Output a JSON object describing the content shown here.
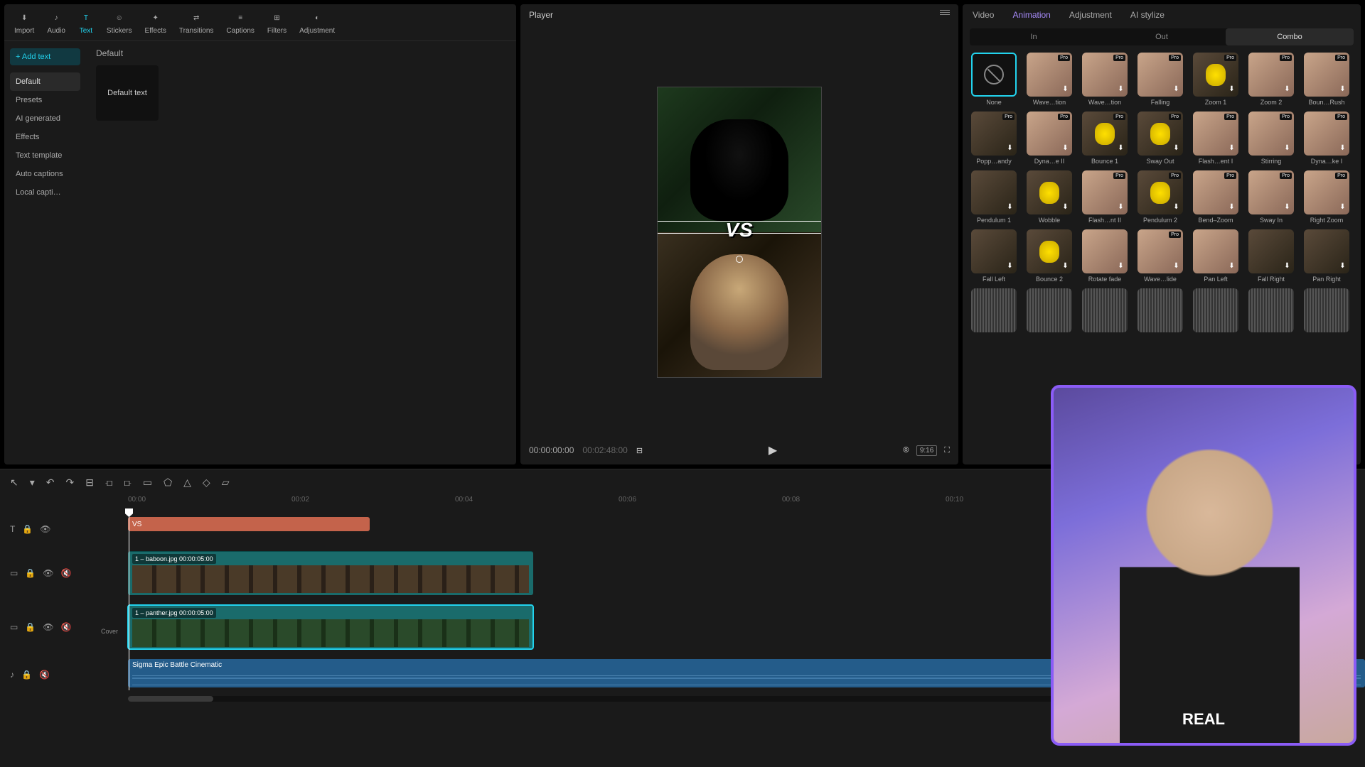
{
  "media_nav": [
    {
      "label": "Import",
      "icon": "⬇",
      "active": false
    },
    {
      "label": "Audio",
      "icon": "♪",
      "active": false
    },
    {
      "label": "Text",
      "icon": "T",
      "active": true
    },
    {
      "label": "Stickers",
      "icon": "☺",
      "active": false
    },
    {
      "label": "Effects",
      "icon": "✦",
      "active": false
    },
    {
      "label": "Transitions",
      "icon": "⇄",
      "active": false
    },
    {
      "label": "Captions",
      "icon": "≡",
      "active": false
    },
    {
      "label": "Filters",
      "icon": "⊞",
      "active": false
    },
    {
      "label": "Adjustment",
      "icon": "◐",
      "active": false
    }
  ],
  "add_text_btn": "+ Add text",
  "left_sidebar": [
    {
      "label": "Default",
      "active": true
    },
    {
      "label": "Presets",
      "active": false
    },
    {
      "label": "AI generated",
      "active": false
    },
    {
      "label": "Effects",
      "active": false
    },
    {
      "label": "Text template",
      "active": false
    },
    {
      "label": "Auto captions",
      "active": false
    },
    {
      "label": "Local capti…",
      "active": false
    }
  ],
  "left_content": {
    "heading": "Default",
    "card": "Default text"
  },
  "player": {
    "title": "Player",
    "current": "00:00:00:00",
    "duration": "00:02:48:00",
    "vs_text": "VS",
    "ratio": "9:16"
  },
  "prop_tabs": [
    {
      "label": "Video",
      "active": false
    },
    {
      "label": "Animation",
      "active": true
    },
    {
      "label": "Adjustment",
      "active": false
    },
    {
      "label": "AI stylize",
      "active": false
    }
  ],
  "anim_subtabs": [
    {
      "label": "In",
      "active": false
    },
    {
      "label": "Out",
      "active": false
    },
    {
      "label": "Combo",
      "active": true
    }
  ],
  "anim_items": [
    {
      "label": "None",
      "variant": "none",
      "pro": false,
      "dl": false
    },
    {
      "label": "Wave…tion",
      "variant": "skin",
      "pro": true,
      "dl": true
    },
    {
      "label": "Wave…tion",
      "variant": "skin",
      "pro": true,
      "dl": true
    },
    {
      "label": "Falling",
      "variant": "skin",
      "pro": true,
      "dl": true
    },
    {
      "label": "Zoom 1",
      "variant": "yellow",
      "pro": true,
      "dl": true
    },
    {
      "label": "Zoom 2",
      "variant": "skin",
      "pro": true,
      "dl": true
    },
    {
      "label": "Boun…Rush",
      "variant": "skin",
      "pro": true,
      "dl": true
    },
    {
      "label": "Popp…andy",
      "variant": "",
      "pro": true,
      "dl": true
    },
    {
      "label": "Dyna…e II",
      "variant": "skin",
      "pro": true,
      "dl": true
    },
    {
      "label": "Bounce 1",
      "variant": "yellow",
      "pro": true,
      "dl": true
    },
    {
      "label": "Sway Out",
      "variant": "yellow",
      "pro": true,
      "dl": true
    },
    {
      "label": "Flash…ent I",
      "variant": "skin",
      "pro": true,
      "dl": true
    },
    {
      "label": "Stirring",
      "variant": "skin",
      "pro": true,
      "dl": true
    },
    {
      "label": "Dyna…ke I",
      "variant": "skin",
      "pro": true,
      "dl": true
    },
    {
      "label": "Pendulum 1",
      "variant": "",
      "pro": false,
      "dl": true
    },
    {
      "label": "Wobble",
      "variant": "yellow",
      "pro": false,
      "dl": true
    },
    {
      "label": "Flash…nt II",
      "variant": "skin",
      "pro": true,
      "dl": true
    },
    {
      "label": "Pendulum 2",
      "variant": "yellow",
      "pro": true,
      "dl": true
    },
    {
      "label": "Bend–Zoom",
      "variant": "skin",
      "pro": true,
      "dl": true
    },
    {
      "label": "Sway In",
      "variant": "skin",
      "pro": true,
      "dl": true
    },
    {
      "label": "Right Zoom",
      "variant": "skin",
      "pro": true,
      "dl": true
    },
    {
      "label": "Fall Left",
      "variant": "",
      "pro": false,
      "dl": true
    },
    {
      "label": "Bounce 2",
      "variant": "yellow",
      "pro": false,
      "dl": true
    },
    {
      "label": "Rotate fade",
      "variant": "skin",
      "pro": false,
      "dl": true
    },
    {
      "label": "Wave…lide",
      "variant": "skin",
      "pro": true,
      "dl": true
    },
    {
      "label": "Pan Left",
      "variant": "skin",
      "pro": false,
      "dl": true
    },
    {
      "label": "Fall Right",
      "variant": "",
      "pro": false,
      "dl": true
    },
    {
      "label": "Pan Right",
      "variant": "",
      "pro": false,
      "dl": true
    },
    {
      "label": "",
      "variant": "grey",
      "pro": false,
      "dl": false
    },
    {
      "label": "",
      "variant": "grey",
      "pro": false,
      "dl": false
    },
    {
      "label": "",
      "variant": "grey",
      "pro": false,
      "dl": false
    },
    {
      "label": "",
      "variant": "grey",
      "pro": false,
      "dl": false
    },
    {
      "label": "",
      "variant": "grey",
      "pro": false,
      "dl": false
    },
    {
      "label": "",
      "variant": "grey",
      "pro": false,
      "dl": false
    },
    {
      "label": "",
      "variant": "grey",
      "pro": false,
      "dl": false
    }
  ],
  "ruler": [
    "00:00",
    "00:02",
    "00:04",
    "00:06",
    "00:08",
    "00:10"
  ],
  "timeline": {
    "text_clip": {
      "label": "VS"
    },
    "media1": {
      "label": "1 – baboon.jpg   00:00:05:00"
    },
    "media2": {
      "label": "1 – panther.jpg   00:00:05:00"
    },
    "audio": {
      "label": "Sigma Epic Battle Cinematic"
    },
    "cover": "Cover"
  },
  "webcam_text": "REAL"
}
